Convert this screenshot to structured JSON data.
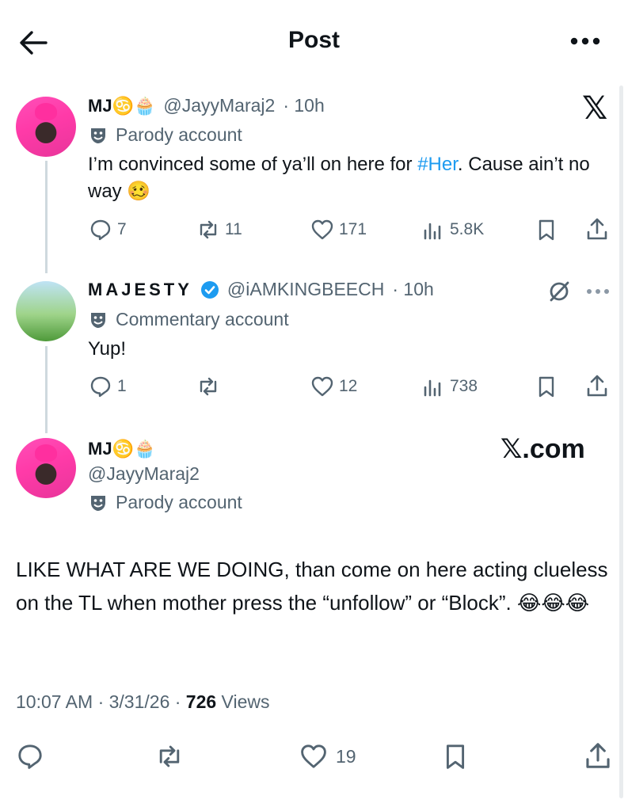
{
  "header": {
    "title": "Post",
    "back_icon": "arrow-left-icon",
    "more_icon": "ellipsis-icon"
  },
  "reply1": {
    "name": "MJ♋️🧁",
    "handle": "@JayyMaraj2",
    "time": "· 10h",
    "label": "Parody account",
    "text_before": "I’m convinced some of ya’ll on here for ",
    "hashtag": "#Her",
    "text_after": ". Cause ain’t no way 🥴",
    "replies": "7",
    "reposts": "11",
    "likes": "171",
    "views": "5.8K",
    "logo": "𝕏"
  },
  "reply2": {
    "name": "MAJESTY",
    "verified": true,
    "handle": "@iAMKINGBEECH",
    "time": "· 10h",
    "label": "Commentary account",
    "text": "Yup!",
    "replies": "1",
    "reposts": "",
    "likes": "12",
    "views": "738",
    "grok_icon": "slash-circle-icon"
  },
  "main": {
    "name": "MJ♋️🧁",
    "handle": "@JayyMaraj2",
    "label": "Parody account",
    "watermark": "𝕏.com",
    "text": "LIKE WHAT ARE WE DOING, than come on here acting clueless on the TL when mother press the “unfollow” or “Block”. 😂😂😂",
    "time": "10:07 AM · 3/31/26 · ",
    "views_count": "726",
    "views_label": " Views",
    "likes": "19"
  },
  "colors": {
    "accent": "#1d9bf0",
    "muted": "#536471",
    "text": "#0f1419",
    "verified": "#1d9bf0"
  }
}
